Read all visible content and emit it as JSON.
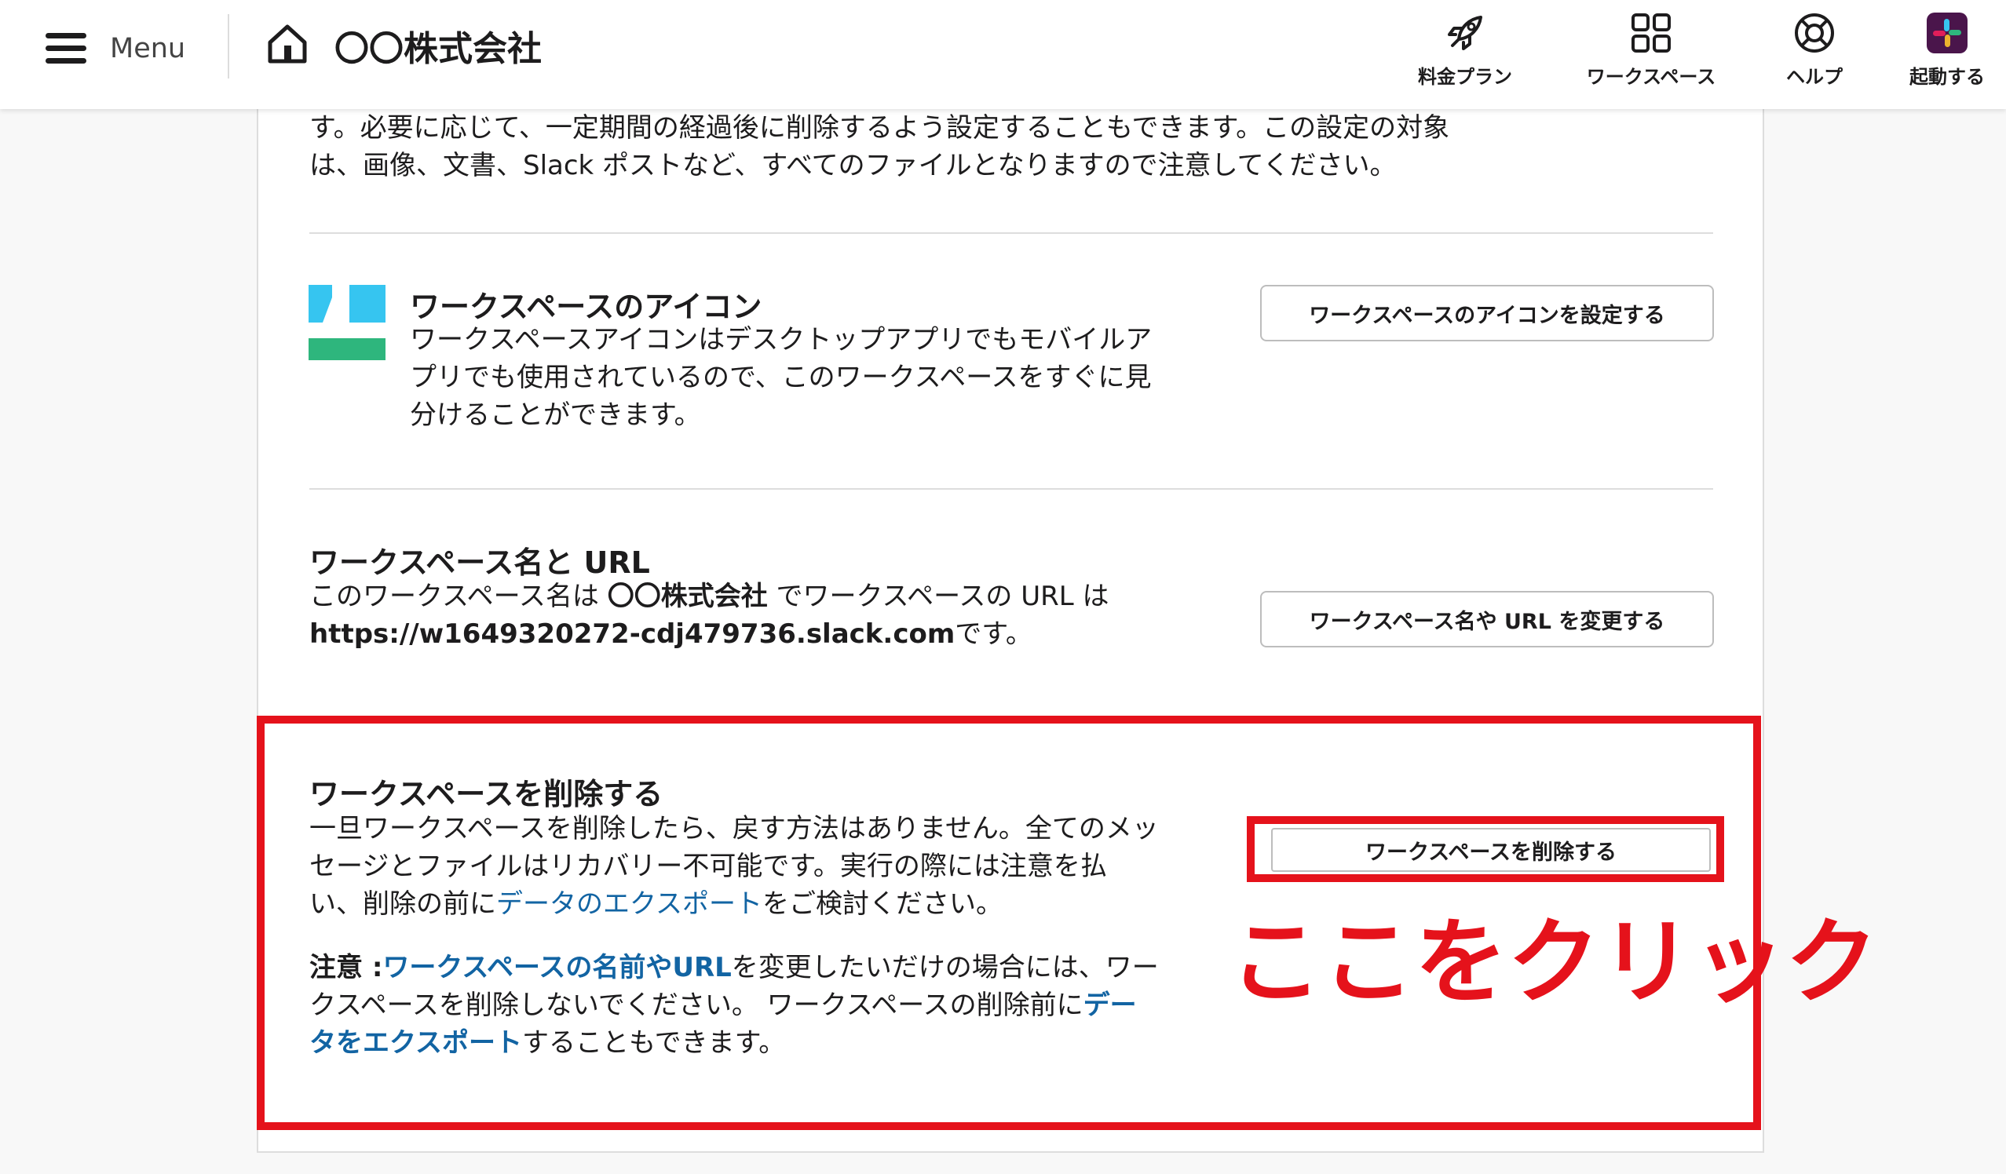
{
  "header": {
    "menu_label": "Menu",
    "workspace_name": "〇〇株式会社",
    "nav": [
      {
        "label": "料金プラン",
        "icon": "rocket-icon"
      },
      {
        "label": "ワークスペース",
        "icon": "grid-icon"
      },
      {
        "label": "ヘルプ",
        "icon": "lifebuoy-icon"
      },
      {
        "label": "起動する",
        "icon": "slack-logo-icon"
      }
    ]
  },
  "file_retention": {
    "text_line1": "す。必要に応じて、一定期間の経過後に削除するよう設定することもできます。この設定の対象",
    "text_line2": "は、画像、文書、Slack ポストなど、すべてのファイルとなりますので注意してください。"
  },
  "workspace_icon": {
    "title": "ワークスペースのアイコン",
    "desc_line1": "ワークスペースアイコンはデスクトップアプリでもモバイルア",
    "desc_line2": "プリでも使用されているので、このワークスペースをすぐに見",
    "desc_line3": "分けることができます。",
    "button": "ワークスペースのアイコンを設定する",
    "colors": {
      "cyan": "#36c5f0",
      "green": "#2eb67d"
    }
  },
  "workspace_name_url": {
    "title": "ワークスペース名と URL",
    "line1_prefix": "このワークスペース名は ",
    "line1_name": "〇〇株式会社",
    "line1_suffix": " でワークスペースの URL は",
    "url": "https://w1649320272-cdj479736.slack.com",
    "url_suffix": "です。",
    "button": "ワークスペース名や URL を変更する"
  },
  "delete_workspace": {
    "title": "ワークスペースを削除する",
    "p1_line1": "一旦ワークスペースを削除したら、戻す方法はありません。全てのメッ",
    "p1_line2": "セージとファイルはリカバリー不可能です。実行の際には注意を払",
    "p1_line3_prefix": "い、削除の前に",
    "p1_line3_link": "データのエクスポート",
    "p1_line3_suffix": "をご検討ください。",
    "note_label": "注意 :",
    "note_link1": "ワークスペースの名前やURL",
    "note_line1_suffix": "を変更したいだけの場合には、ワー",
    "note_line2_prefix": "クスペースを削除しないでください。 ワークスペースの削除前に",
    "note_link2_part1": "デー",
    "note_link2_part2": "タをエクスポート",
    "note_line3_suffix": "することもできます。",
    "button": "ワークスペースを削除する"
  },
  "annotation": {
    "text": "ここをクリック",
    "color": "#e5121b"
  }
}
